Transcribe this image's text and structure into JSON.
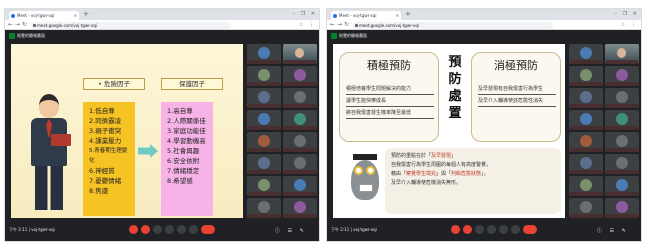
{
  "colors": {
    "meet_dark": "#202124",
    "tile_gray": "#3c4043",
    "end_call_red": "#ea4335",
    "risk_yellow": "#f6c324",
    "protect_pink": "#f7b3e8",
    "arrow_teal": "#6ecbc4"
  },
  "left": {
    "tab": "Meet - voj-tgwr-xqi",
    "address": "meet.google.com/voj-tgwr-xqi",
    "meet_title": "佩雯的簡報畫面",
    "footer_time": "下午 2:11 | voj-tgwr-xqi",
    "risk_label": "危險因子",
    "protect_label": "保護因子",
    "risk_items": [
      "1.低自尊",
      "2.同儕霸凌",
      "3.親子衝突",
      "4.課業壓力",
      "5.青春期生理變化",
      "6.神經質",
      "7.憂鬱情緒",
      "8.焦慮"
    ],
    "protect_items": [
      "1.高自尊",
      "2.人際關係佳",
      "3.家庭功能佳",
      "4.學習動機高",
      "5.社會興趣",
      "6.安全依附",
      "7.情緒穩定",
      "8.希望感"
    ]
  },
  "right": {
    "tab": "Meet - voj-tgwr-xqi",
    "address": "meet.google.com/voj-tgwr-xqi",
    "meet_title": "佩雯的簡報畫面",
    "footer_time": "下午 2:11 | voj-tgwr-xqi",
    "positive_title": "積極預防",
    "positive_lines": [
      "積極培養學生問題解決的能力",
      "讓學生能快樂成長",
      "將自我傷害發生機率降至最低"
    ],
    "center_title": [
      "預",
      "防",
      "處",
      "置"
    ],
    "negative_title": "消極預防",
    "negative_lines": [
      "及早發現有自我傷害行為學生",
      "及早介入輔導使該危險性消失"
    ],
    "owl_text": {
      "l1_pre": "預防的重點在於「",
      "l1_hl": "及早發現",
      "l1_post": "」",
      "l2": "自我傷害行為學生周圍的每個人有高度警覺，",
      "l3_pre": "藉由「",
      "l3_hl1": "察覺學生徵兆",
      "l3_mid": "」與「",
      "l3_hl2": "判斷危險狀態",
      "l3_post": "」，",
      "l4": "及早介入輔導使危機消失無形。"
    }
  }
}
